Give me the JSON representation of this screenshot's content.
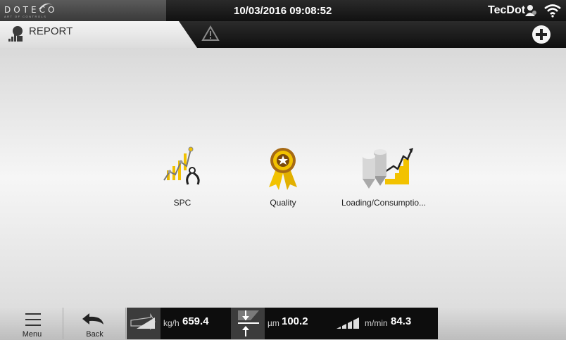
{
  "header": {
    "logo_text": "DOTECO",
    "logo_tagline": "ART OF CONTROLS",
    "datetime": "10/03/2016 09:08:52",
    "user": "TecDot"
  },
  "titlebar": {
    "title": "REPORT"
  },
  "tiles": [
    {
      "label": "SPC",
      "icon": "spc-chart-icon"
    },
    {
      "label": "Quality",
      "icon": "quality-medal-icon"
    },
    {
      "label": "Loading/Consumptio...",
      "icon": "loading-consumption-icon"
    }
  ],
  "bottom": {
    "menu_label": "Menu",
    "back_label": "Back",
    "gauges": [
      {
        "unit": "kg/h",
        "value": "659.4",
        "icon": "throughput-icon"
      },
      {
        "unit": "µm",
        "value": "100.2",
        "icon": "thickness-icon"
      },
      {
        "unit": "m/min",
        "value": "84.3",
        "icon": "speed-icon"
      }
    ]
  },
  "colors": {
    "accent_yellow": "#f2c200",
    "bar_dark": "#111111"
  }
}
